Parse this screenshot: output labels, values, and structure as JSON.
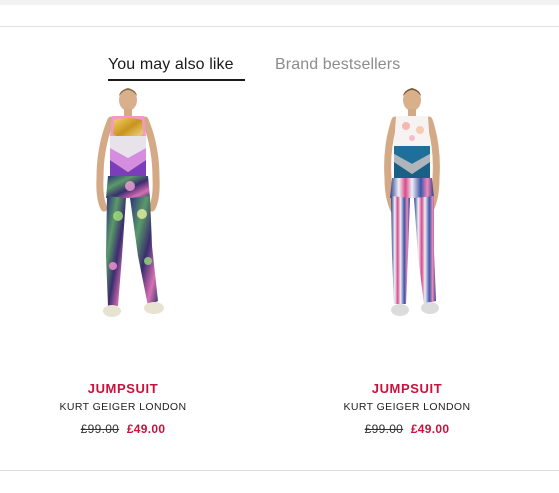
{
  "tabs": {
    "active_label": "You may also like",
    "inactive_label": "Brand bestsellers"
  },
  "products": [
    {
      "name": "JUMPSUIT",
      "brand": "KURT GEIGER LONDON",
      "price_old": "£99.00",
      "price_new": "£49.00"
    },
    {
      "name": "JUMPSUIT",
      "brand": "KURT GEIGER LONDON",
      "price_old": "£99.00",
      "price_new": "£49.00"
    }
  ],
  "colors": {
    "accent_red": "#c7133d",
    "text_dark": "#1a1a1a",
    "text_muted": "#8c8c8c"
  }
}
